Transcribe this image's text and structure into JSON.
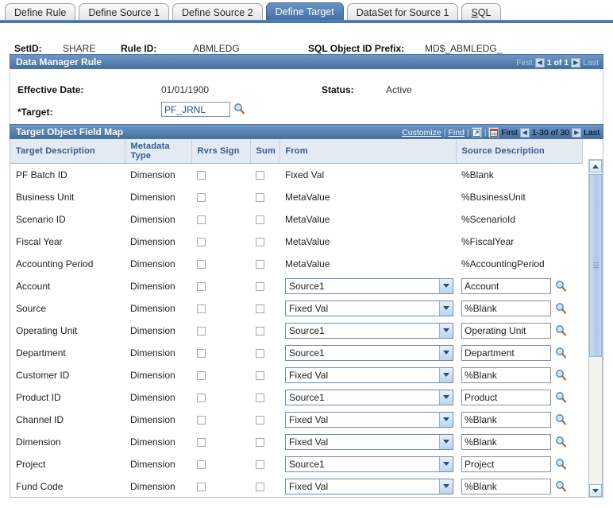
{
  "tabs": [
    {
      "label": "Define Rule",
      "active": false
    },
    {
      "label": "Define Source 1",
      "active": false
    },
    {
      "label": "Define Source 2",
      "active": false
    },
    {
      "label": "Define Target",
      "active": true
    },
    {
      "label": "DataSet for Source 1",
      "active": false
    },
    {
      "label": "SQL",
      "active": false,
      "accesskey": "S"
    }
  ],
  "key_fields": {
    "setid_label": "SetID:",
    "setid_value": "SHARE",
    "rule_id_label": "Rule ID:",
    "rule_id_value": "ABMLEDG",
    "sql_prefix_label": "SQL Object ID Prefix:",
    "sql_prefix_value": "MD$_ABMLEDG_"
  },
  "section": {
    "title": "Data Manager Rule",
    "nav": {
      "first": "First",
      "counter": "1 of 1",
      "last": "Last"
    }
  },
  "effective": {
    "date_label": "Effective Date:",
    "date_value": "01/01/1900",
    "status_label": "Status:",
    "status_value": "Active",
    "target_label": "*Target:",
    "target_value": "PF_JRNL",
    "lookup_icon": "magnifier-icon"
  },
  "grid": {
    "title": "Target Object Field Map",
    "customize_label": "Customize",
    "find_label": "Find",
    "view_all_icon": "view-all-icon",
    "download_icon": "download-grid-icon",
    "nav": {
      "first": "First",
      "counter": "1-30 of 30",
      "last": "Last"
    },
    "columns": [
      "Target Description",
      "Metadata Type",
      "Rvrs Sign",
      "Sum",
      "From",
      "Source Description"
    ],
    "rows": [
      {
        "target": "PF Batch ID",
        "metadata": "Dimension",
        "rvrs": false,
        "sum": false,
        "from": "Fixed Val",
        "from_type": "text",
        "source": "%Blank",
        "source_type": "text"
      },
      {
        "target": "Business Unit",
        "metadata": "Dimension",
        "rvrs": false,
        "sum": false,
        "from": "MetaValue",
        "from_type": "text",
        "source": "%BusinessUnit",
        "source_type": "text"
      },
      {
        "target": "Scenario ID",
        "metadata": "Dimension",
        "rvrs": false,
        "sum": false,
        "from": "MetaValue",
        "from_type": "text",
        "source": "%ScenarioId",
        "source_type": "text"
      },
      {
        "target": "Fiscal Year",
        "metadata": "Dimension",
        "rvrs": false,
        "sum": false,
        "from": "MetaValue",
        "from_type": "text",
        "source": "%FiscalYear",
        "source_type": "text"
      },
      {
        "target": "Accounting Period",
        "metadata": "Dimension",
        "rvrs": false,
        "sum": false,
        "from": "MetaValue",
        "from_type": "text",
        "source": "%AccountingPeriod",
        "source_type": "text"
      },
      {
        "target": "Account",
        "metadata": "Dimension",
        "rvrs": false,
        "sum": false,
        "from": "Source1",
        "from_type": "select",
        "source": "Account",
        "source_type": "lookup"
      },
      {
        "target": "Source",
        "metadata": "Dimension",
        "rvrs": false,
        "sum": false,
        "from": "Fixed Val",
        "from_type": "select",
        "source": "%Blank",
        "source_type": "lookup"
      },
      {
        "target": "Operating Unit",
        "metadata": "Dimension",
        "rvrs": false,
        "sum": false,
        "from": "Source1",
        "from_type": "select",
        "source": "Operating Unit",
        "source_type": "lookup"
      },
      {
        "target": "Department",
        "metadata": "Dimension",
        "rvrs": false,
        "sum": false,
        "from": "Source1",
        "from_type": "select",
        "source": "Department",
        "source_type": "lookup"
      },
      {
        "target": "Customer ID",
        "metadata": "Dimension",
        "rvrs": false,
        "sum": false,
        "from": "Fixed Val",
        "from_type": "select",
        "source": "%Blank",
        "source_type": "lookup"
      },
      {
        "target": "Product ID",
        "metadata": "Dimension",
        "rvrs": false,
        "sum": false,
        "from": "Source1",
        "from_type": "select",
        "source": "Product",
        "source_type": "lookup"
      },
      {
        "target": "Channel ID",
        "metadata": "Dimension",
        "rvrs": false,
        "sum": false,
        "from": "Fixed Val",
        "from_type": "select",
        "source": "%Blank",
        "source_type": "lookup"
      },
      {
        "target": "Dimension",
        "metadata": "Dimension",
        "rvrs": false,
        "sum": false,
        "from": "Fixed Val",
        "from_type": "select",
        "source": "%Blank",
        "source_type": "lookup"
      },
      {
        "target": "Project",
        "metadata": "Dimension",
        "rvrs": false,
        "sum": false,
        "from": "Source1",
        "from_type": "select",
        "source": "Project",
        "source_type": "lookup"
      },
      {
        "target": "Fund Code",
        "metadata": "Dimension",
        "rvrs": false,
        "sum": false,
        "from": "Fixed Val",
        "from_type": "select",
        "source": "%Blank",
        "source_type": "lookup"
      }
    ]
  },
  "scrollbar": {
    "up_icon": "scroll-up-icon",
    "down_icon": "scroll-down-icon",
    "thumb": "scroll-thumb"
  },
  "colors": {
    "active_tab": "#3f6ea7",
    "section_bar": "#44709f",
    "column_header_text": "#2d5c94",
    "input_text_blue": "#26518c"
  }
}
